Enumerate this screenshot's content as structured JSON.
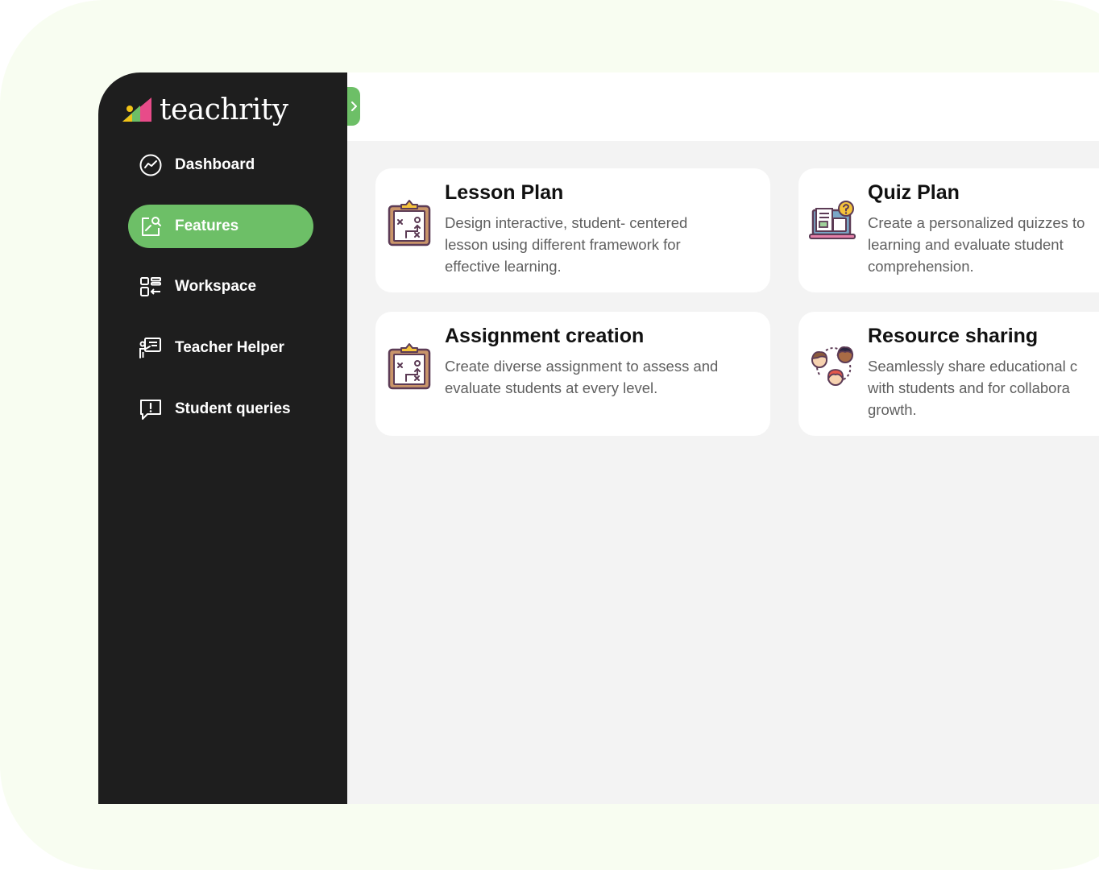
{
  "brand": {
    "name": "teachrity"
  },
  "sidebar": {
    "items": [
      {
        "label": "Dashboard",
        "icon": "dashboard-icon"
      },
      {
        "label": "Features",
        "icon": "features-icon",
        "active": true
      },
      {
        "label": "Workspace",
        "icon": "workspace-icon"
      },
      {
        "label": "Teacher Helper",
        "icon": "teacher-helper-icon"
      },
      {
        "label": "Student queries",
        "icon": "student-queries-icon"
      }
    ]
  },
  "features": [
    {
      "title": "Lesson Plan",
      "description": "Design interactive, student- centered\nlesson using different framework for\neffective learning.",
      "icon": "clipboard-strategy-icon"
    },
    {
      "title": "Quiz Plan",
      "description": "Create a personalized quizzes to\nlearning and evaluate student\ncomprehension.",
      "icon": "quiz-laptop-icon"
    },
    {
      "title": "Assignment creation",
      "description": "Create diverse assignment to assess and\nevaluate students at every level.",
      "icon": "clipboard-strategy-icon"
    },
    {
      "title": "Resource sharing",
      "description": "Seamlessly share educational c\nwith students and for collabora\ngrowth.",
      "icon": "people-sharing-icon"
    }
  ],
  "colors": {
    "accent": "#6dbf67",
    "sidebar_bg": "#1e1e1e",
    "content_bg": "#f3f3f3",
    "card_bg": "#ffffff",
    "outer_bg": "#f8fdf1"
  }
}
